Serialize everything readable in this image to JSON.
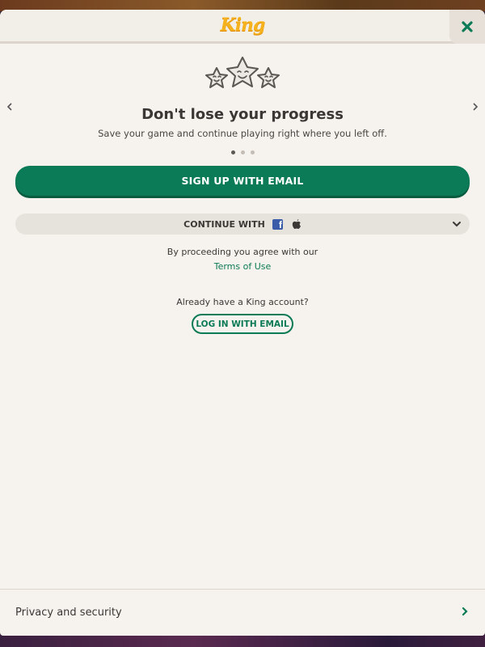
{
  "header": {
    "logo_text": "King",
    "close_icon": "close-x-icon"
  },
  "carousel": {
    "illustration_icon": "three-smiling-stars-icon",
    "title": "Don't lose your progress",
    "subtitle": "Save your game and continue playing right where you left off.",
    "page_count": 3,
    "active_page": 1,
    "prev_icon": "chevron-left-icon",
    "next_icon": "chevron-right-icon"
  },
  "actions": {
    "signup_label": "SIGN UP WITH EMAIL",
    "continue_label": "CONTINUE WITH",
    "continue_icons": [
      "facebook-icon",
      "apple-icon"
    ],
    "expand_icon": "chevron-down-icon"
  },
  "legal": {
    "agree_text": "By proceeding you agree with our",
    "terms_link": "Terms of Use"
  },
  "login": {
    "prompt": "Already have a King account?",
    "button_label": "LOG IN WITH EMAIL"
  },
  "footer": {
    "privacy_label": "Privacy and security",
    "privacy_icon": "chevron-right-icon"
  },
  "colors": {
    "accent_green": "#0b7a56",
    "background": "#f6f3ee",
    "logo_yellow": "#f6b21c",
    "facebook_blue": "#3b5ca8"
  }
}
